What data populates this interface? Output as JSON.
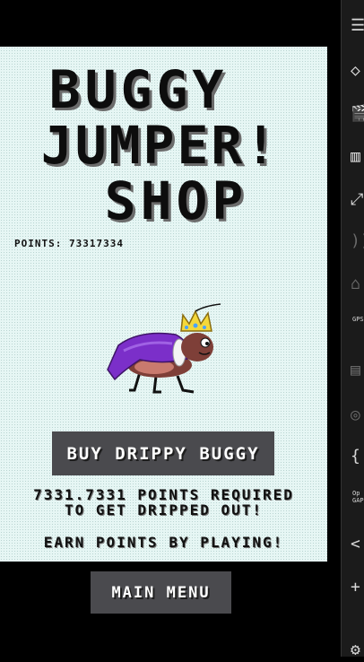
{
  "title": {
    "line1": "BUGGY",
    "line2": "JUMPER!",
    "line3": "SHOP"
  },
  "points": {
    "label": "POINTS:",
    "value": "73317334"
  },
  "buy_button": {
    "label": "BUY DRIPPY BUGGY"
  },
  "requirement": {
    "line1": "7331.7331 POINTS REQUIRED",
    "line2": "TO GET DRIPPED OUT!"
  },
  "earn_text": "EARN POINTS BY PLAYING!",
  "main_menu_button": {
    "label": "MAIN MENU"
  },
  "sidebar": {
    "items": [
      {
        "icon": "menu-icon",
        "glyph": "☰",
        "dim": false
      },
      {
        "icon": "tag-icon",
        "glyph": "◇",
        "dim": false
      },
      {
        "icon": "video-camera-icon",
        "glyph": "🎬",
        "dim": false
      },
      {
        "icon": "panels-icon",
        "glyph": "▥",
        "dim": false
      },
      {
        "icon": "fullscreen-icon",
        "glyph": "⤢",
        "dim": false
      },
      {
        "icon": "wifi-icon",
        "glyph": "))",
        "dim": true
      },
      {
        "icon": "home-icon",
        "glyph": "⌂",
        "dim": true
      },
      {
        "icon": "gps-icon",
        "glyph": "GPS",
        "dim": false
      },
      {
        "icon": "film-icon",
        "glyph": "▤",
        "dim": true
      },
      {
        "icon": "fingerprint-icon",
        "glyph": "◎",
        "dim": true
      },
      {
        "icon": "code-braces-icon",
        "glyph": "{",
        "dim": false
      },
      {
        "icon": "opengapps-icon",
        "glyph": "Op GAP",
        "dim": false
      },
      {
        "icon": "share-icon",
        "glyph": "<",
        "dim": false
      },
      {
        "icon": "add-icon",
        "glyph": "+",
        "dim": false
      },
      {
        "icon": "settings-icon",
        "glyph": "⚙",
        "dim": false
      }
    ]
  },
  "colors": {
    "background": "#e6f6f4",
    "button": "#4a4a4e",
    "cape": "#7b2fc9",
    "crown": "#f4d83a",
    "bug_body": "#7e3f38"
  }
}
